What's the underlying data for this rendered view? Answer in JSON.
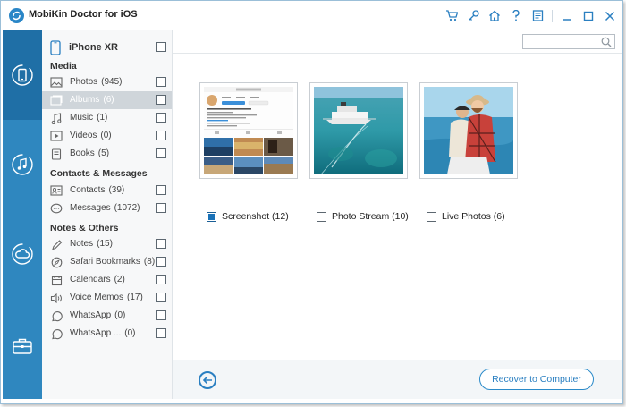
{
  "app": {
    "title": "MobiKin Doctor for iOS"
  },
  "titlebar": {
    "icons": [
      "cart-icon",
      "key-icon",
      "home-icon",
      "help-icon",
      "feedback-icon",
      "minimize-icon",
      "maximize-icon",
      "close-icon"
    ]
  },
  "rail": {
    "items": [
      {
        "name": "recover-from-device",
        "icon": "phone-sync-icon",
        "active": true
      },
      {
        "name": "recover-from-itunes",
        "icon": "music-note-icon",
        "active": false
      },
      {
        "name": "recover-from-icloud",
        "icon": "cloud-sync-icon",
        "active": false
      },
      {
        "name": "toolbox",
        "icon": "toolbox-icon",
        "active": false
      }
    ]
  },
  "device": {
    "name": "iPhone XR"
  },
  "categories": {
    "media_header": "Media",
    "contacts_header": "Contacts & Messages",
    "notes_header": "Notes & Others",
    "items": [
      {
        "label": "Photos",
        "count": "(945)",
        "icon": "photo-icon",
        "selected": false
      },
      {
        "label": "Albums",
        "count": "(6)",
        "icon": "album-icon",
        "selected": true
      },
      {
        "label": "Music",
        "count": "(1)",
        "icon": "music-icon",
        "selected": false
      },
      {
        "label": "Videos",
        "count": "(0)",
        "icon": "video-icon",
        "selected": false
      },
      {
        "label": "Books",
        "count": "(5)",
        "icon": "book-icon",
        "selected": false
      },
      {
        "label": "Contacts",
        "count": "(39)",
        "icon": "contacts-icon",
        "selected": false
      },
      {
        "label": "Messages",
        "count": "(1072)",
        "icon": "messages-icon",
        "selected": false
      },
      {
        "label": "Notes",
        "count": "(15)",
        "icon": "notes-icon",
        "selected": false
      },
      {
        "label": "Safari Bookmarks",
        "count": "(8)",
        "icon": "safari-icon",
        "selected": false
      },
      {
        "label": "Calendars",
        "count": "(2)",
        "icon": "calendar-icon",
        "selected": false
      },
      {
        "label": "Voice Memos",
        "count": "(17)",
        "icon": "voice-memo-icon",
        "selected": false
      },
      {
        "label": "WhatsApp",
        "count": "(0)",
        "icon": "whatsapp-icon",
        "selected": false
      },
      {
        "label": "WhatsApp ...",
        "count": "(0)",
        "icon": "whatsapp-icon",
        "selected": false
      }
    ]
  },
  "search": {
    "value": "",
    "placeholder": ""
  },
  "albums": [
    {
      "label": "Screenshot (12)",
      "checked": true
    },
    {
      "label": "Photo Stream (10)",
      "checked": false
    },
    {
      "label": "Live Photos (6)",
      "checked": false
    }
  ],
  "bottom": {
    "recover_label": "Recover to Computer"
  },
  "colors": {
    "rail": "#2f87bf",
    "rail_active": "#1f6fa6",
    "accent": "#2a7fc1",
    "selected_row": "#cfd5da"
  }
}
